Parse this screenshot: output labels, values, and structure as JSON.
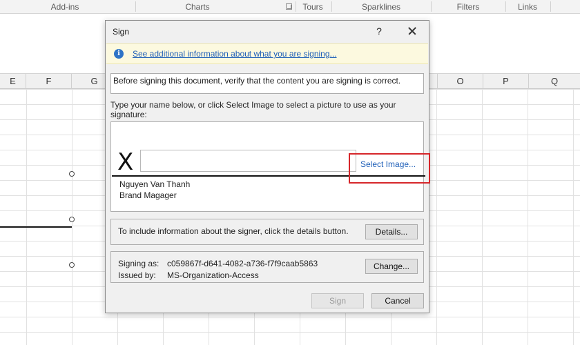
{
  "ribbon": {
    "groups": [
      "Add-ins",
      "Charts",
      "Tours",
      "Sparklines",
      "Filters",
      "Links"
    ]
  },
  "sheet": {
    "columns": [
      "E",
      "F",
      "G",
      "O",
      "P",
      "Q"
    ]
  },
  "dialog": {
    "title": "Sign",
    "help_label": "?",
    "info_link": "See additional information about what you are signing...",
    "verify_text": "Before signing this document, verify that the content you are signing is correct.",
    "instruction": "Type your name below, or click Select Image to select a picture to use as your signature:",
    "signature_x": "X",
    "signature_value": "",
    "select_image": "Select Image...",
    "signer_name": "Nguyen Van Thanh",
    "signer_title": "Brand Magager",
    "details_text": "To include information about the signer, click the details button.",
    "details_button": "Details...",
    "signing_as_label": "Signing as:",
    "signing_as_value": "c059867f-d641-4082-a736-f7f9caab5863",
    "issued_by_label": "Issued by:",
    "issued_by_value": "MS-Organization-Access",
    "change_button": "Change...",
    "sign_button": "Sign",
    "cancel_button": "Cancel"
  },
  "colors": {
    "highlight": "#d6262a",
    "link": "#1f5fb8",
    "info_bar": "#fcf9df"
  }
}
